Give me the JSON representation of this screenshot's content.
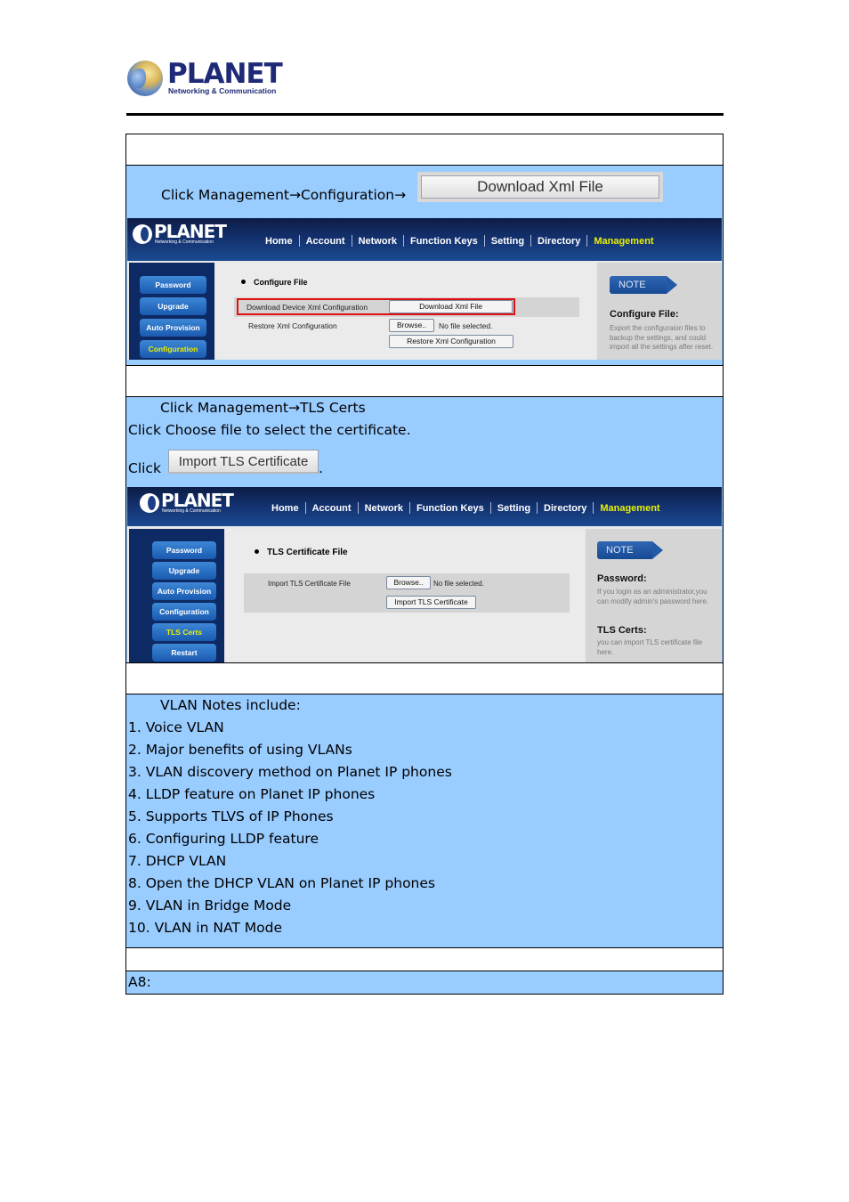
{
  "header": {
    "logo_brand": "PLANET",
    "logo_tagline": "Networking & Communication"
  },
  "rows": {
    "r1_blank": "",
    "r2": {
      "instruction": "Click Management→Configuration→",
      "button_image_label": "Download Xml File"
    },
    "r4": {
      "line1": "Click Management→TLS Certs",
      "line2": "Click Choose file to select the certificate.",
      "line3_prefix": "Click",
      "line3_button": "Import TLS Certificate",
      "line3_suffix": "."
    },
    "vlan": {
      "heading": "VLAN Notes include:",
      "items": [
        "1. Voice VLAN",
        "2. Major benefits of using VLANs",
        "3. VLAN discovery method on Planet IP phones",
        "4. LLDP feature on Planet IP phones",
        "5. Supports TLVS of IP Phones",
        "6. Configuring LLDP feature",
        "7. DHCP VLAN",
        "8. Open the DHCP VLAN on Planet IP phones",
        "9. VLAN in Bridge Mode",
        "10. VLAN in NAT Mode"
      ]
    },
    "answer_label": "A8:"
  },
  "webui": {
    "logo_brand": "PLANET",
    "logo_tagline": "Networking & Communication",
    "nav": [
      "Home",
      "Account",
      "Network",
      "Function Keys",
      "Setting",
      "Directory",
      "Management"
    ],
    "nav_active": "Management",
    "accent_color": "#e8f000"
  },
  "shot1": {
    "sidebar": [
      "Password",
      "Upgrade",
      "Auto Provision",
      "Configuration"
    ],
    "sidebar_active": "Configuration",
    "section_title": "Configure File",
    "download_label": "Download Device Xml Configuration",
    "download_button": "Download Xml File",
    "restore_label": "Restore Xml Configuration",
    "browse_button": "Browse..",
    "no_file": "No file selected.",
    "restore_button": "Restore Xml Configuration",
    "note_badge": "NOTE",
    "note_title": "Configure File:",
    "note_text": "Export the configuraion files to backup the settings, and could import all the settings after reset."
  },
  "shot2": {
    "sidebar": [
      "Password",
      "Upgrade",
      "Auto Provision",
      "Configuration",
      "TLS Certs",
      "Restart"
    ],
    "sidebar_active": "TLS Certs",
    "section_title": "TLS Certificate File",
    "import_label": "Import TLS Certificate File",
    "browse_button": "Browse..",
    "no_file": "No file selected.",
    "import_button": "Import TLS Certificate",
    "note_badge": "NOTE",
    "note1_title": "Password:",
    "note1_text": "If you login as an administrator,you can modify admin's password here.",
    "note2_title": "TLS Certs:",
    "note2_text": "you can import TLS certificate file here."
  },
  "colors": {
    "row_blue": "#99ccff",
    "highlight_red": "#e01010"
  }
}
